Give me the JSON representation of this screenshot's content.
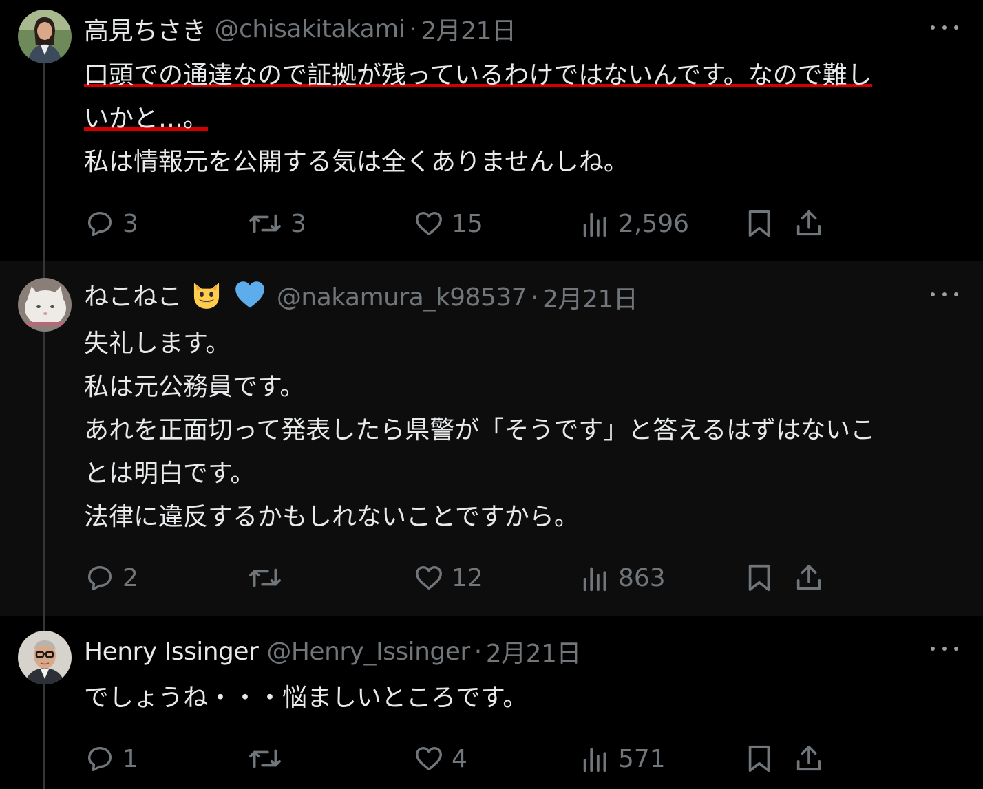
{
  "tweets": [
    {
      "name": "高見ちさき",
      "handle": "@chisakitakami",
      "date": "2月21日",
      "underlined_lines": [
        "口頭での通達なので証拠が残っているわけではないんです。なので難し",
        "いかと…。"
      ],
      "lines": [
        "私は情報元を公開する気は全くありませんしね。"
      ],
      "replies": "3",
      "retweets": "3",
      "likes": "15",
      "views": "2,596"
    },
    {
      "name": "ねこねこ",
      "name_emojis": [
        "smiling-cat-emoji",
        "blue-heart-emoji"
      ],
      "handle": "@nakamura_k98537",
      "date": "2月21日",
      "lines": [
        "失礼します。",
        "私は元公務員です。",
        "あれを正面切って発表したら県警が「そうです」と答えるはずはないこ",
        "とは明白です。",
        "法律に違反するかもしれないことですから。"
      ],
      "replies": "2",
      "retweets": "",
      "likes": "12",
      "views": "863"
    },
    {
      "name": "Henry Issinger",
      "handle": "@Henry_Issinger",
      "date": "2月21日",
      "lines": [
        "でしょうね・・・悩ましいところです。"
      ],
      "replies": "1",
      "retweets": "",
      "likes": "4",
      "views": "571"
    }
  ],
  "separator": "·",
  "icons": {
    "reply": "speech-bubble-icon",
    "retweet": "retweet-arrows-icon",
    "like": "heart-outline-icon",
    "views": "bar-chart-icon",
    "bookmark": "bookmark-icon",
    "share": "upload-arrow-icon",
    "more": "three-dots-icon"
  },
  "colors": {
    "background": "#000000",
    "alt_background": "#0d0d0d",
    "text": "#e7e9ea",
    "muted": "#71767b",
    "underline": "#d40000"
  }
}
